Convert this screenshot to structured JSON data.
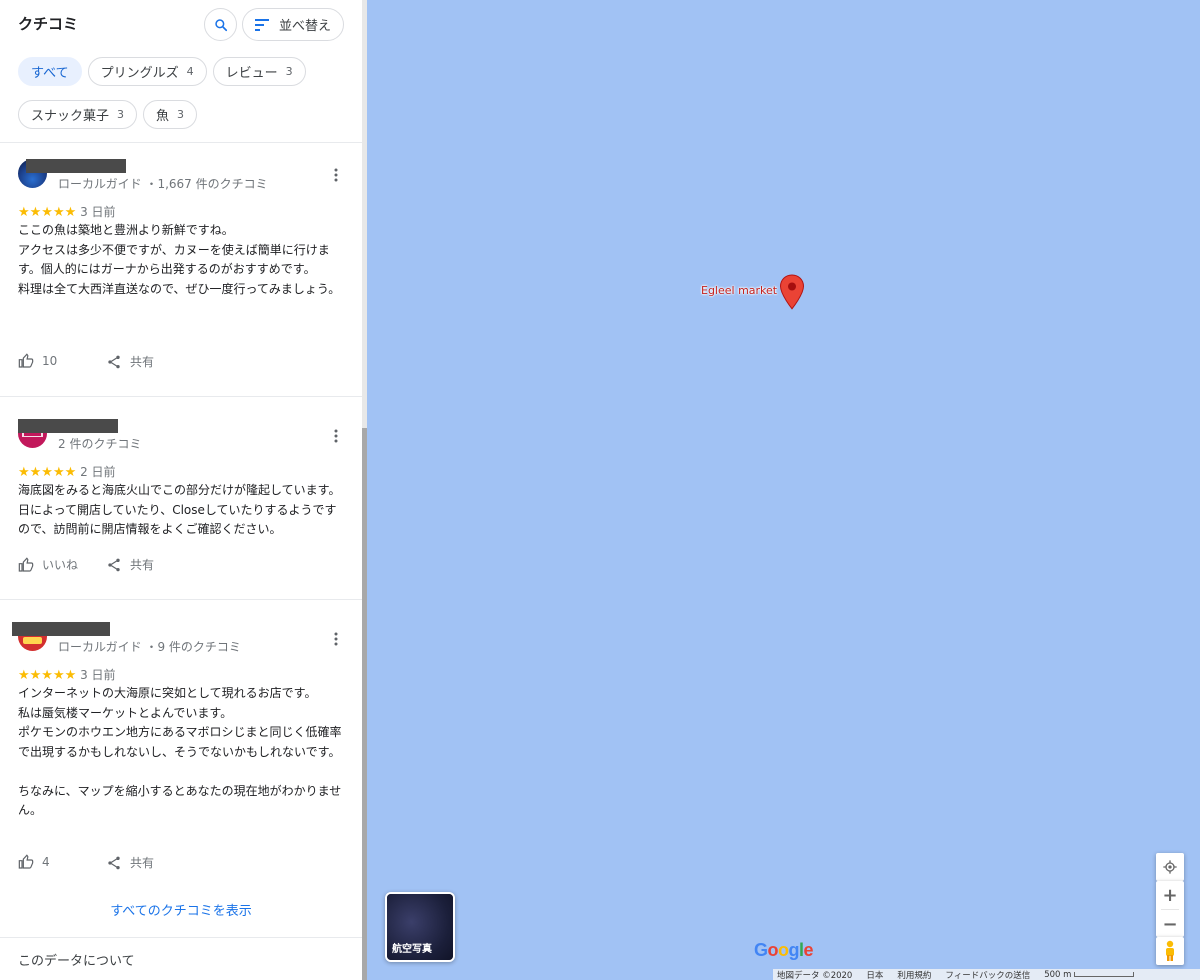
{
  "panel": {
    "title": "クチコミ",
    "sort_label": "並べ替え",
    "chips_row1": [
      {
        "label": "すべて",
        "count": ""
      },
      {
        "label": "プリングルズ",
        "count": "4"
      },
      {
        "label": "レビュー",
        "count": "3"
      }
    ],
    "chips_row2": [
      {
        "label": "スナック菓子",
        "count": "3"
      },
      {
        "label": "魚",
        "count": "3"
      }
    ],
    "reviews": [
      {
        "meta": "ローカルガイド ・1,667 件のクチコミ",
        "stars": "★★★★★",
        "date": "3 日前",
        "text": "ここの魚は築地と豊洲より新鮮ですね。\nアクセスは多少不便ですが、カヌーを使えば簡単に行けます。個人的にはガーナから出発するのがおすすめです。\n料理は全て大西洋直送なので、ぜひ一度行ってみましょう。",
        "like": "10",
        "share": "共有"
      },
      {
        "meta": "2 件のクチコミ",
        "stars": "★★★★★",
        "date": "2 日前",
        "text": "海底図をみると海底火山でこの部分だけが隆起しています。日によって開店していたり、Closeしていたりするようですので、訪問前に開店情報をよくご確認ください。",
        "like": "いいね",
        "share": "共有"
      },
      {
        "meta": "ローカルガイド ・9 件のクチコミ",
        "stars": "★★★★★",
        "date": "3 日前",
        "text": "インターネットの大海原に突如として現れるお店です。\n私は蜃気楼マーケットとよんでいます。\nポケモンのホウエン地方にあるマボロシじまと同じく低確率で出現するかもしれないし、そうでないかもしれないです。\n\nちなみに、マップを縮小するとあなたの現在地がわかりません。",
        "like": "4",
        "share": "共有"
      }
    ],
    "show_all": "すべてのクチコミを表示",
    "about": "このデータについて"
  },
  "map": {
    "pin_label": "Egleel market",
    "satellite_label": "航空写真",
    "google_logo": "Google",
    "footer": {
      "map_data": "地図データ ©2020",
      "country": "日本",
      "terms": "利用規約",
      "feedback": "フィードバックの送信",
      "scale": "500 m"
    },
    "water_color": "#a1c2f4",
    "pin_color": "#ea4335"
  }
}
